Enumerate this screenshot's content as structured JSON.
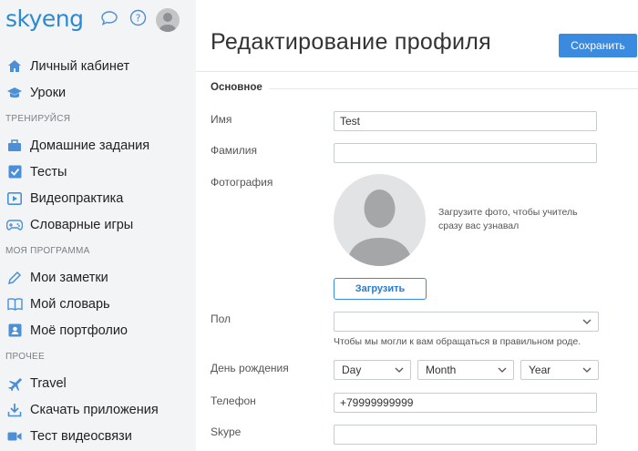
{
  "app": {
    "logo": "skyeng"
  },
  "sidebar": {
    "items": [
      {
        "label": "Личный кабинет",
        "icon": "home-icon"
      },
      {
        "label": "Уроки",
        "icon": "graduation-cap-icon"
      },
      {
        "section": "ТРЕНИРУЙСЯ"
      },
      {
        "label": "Домашние задания",
        "icon": "briefcase-icon"
      },
      {
        "label": "Тесты",
        "icon": "checkbox-icon"
      },
      {
        "label": "Видеопрактика",
        "icon": "play-icon"
      },
      {
        "label": "Словарные игры",
        "icon": "gamepad-icon"
      },
      {
        "section": "МОЯ ПРОГРАММА"
      },
      {
        "label": "Мои заметки",
        "icon": "pencil-icon"
      },
      {
        "label": "Мой словарь",
        "icon": "book-icon"
      },
      {
        "label": "Моё портфолио",
        "icon": "portfolio-icon"
      },
      {
        "section": "ПРОЧЕЕ"
      },
      {
        "label": "Travel",
        "icon": "plane-icon"
      },
      {
        "label": "Скачать приложения",
        "icon": "download-icon"
      },
      {
        "label": "Тест видеосвязи",
        "icon": "video-camera-icon"
      }
    ]
  },
  "header": {
    "title": "Редактирование профиля",
    "save_label": "Сохранить"
  },
  "form": {
    "section": "Основное",
    "name_label": "Имя",
    "name_value": "Test",
    "surname_label": "Фамилия",
    "surname_value": "",
    "photo_label": "Фотография",
    "photo_hint": "Загрузите фото, чтобы учитель сразу вас узнавал",
    "upload_label": "Загрузить",
    "gender_label": "Пол",
    "gender_value": "",
    "gender_hint": "Чтобы мы могли к вам обращаться в правильном роде.",
    "birthday_label": "День рождения",
    "day_value": "Day",
    "month_value": "Month",
    "year_value": "Year",
    "phone_label": "Телефон",
    "phone_value": "+79999999999",
    "skype_label": "Skype",
    "skype_value": ""
  },
  "colors": {
    "accent": "#3a8ae0",
    "sidebar_bg": "#f3f4f6",
    "icon": "#4a8fd8"
  }
}
